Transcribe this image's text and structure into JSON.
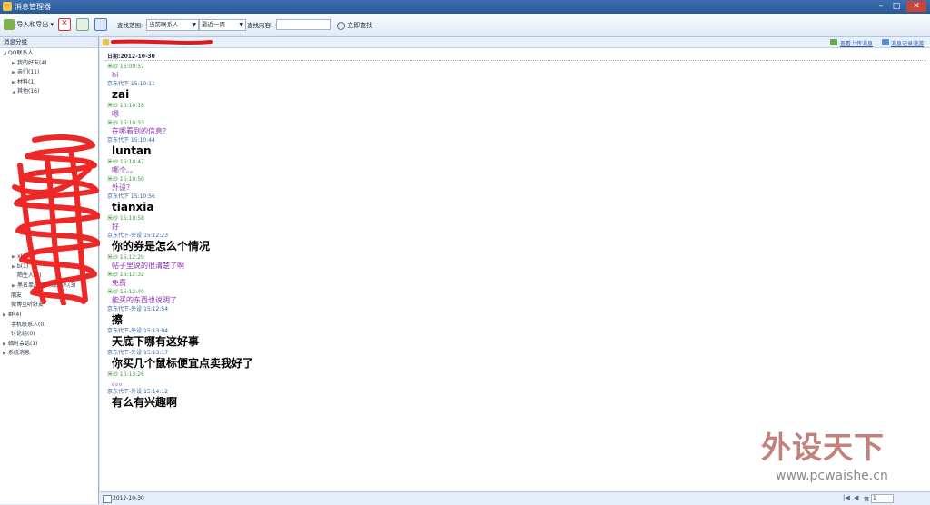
{
  "window": {
    "title": "消息管理器"
  },
  "toolbar": {
    "import_export_label": "导入和导出",
    "scope_label": "查找范围:",
    "scope_value": "当前联系人",
    "range_value": "最近一周",
    "content_label": "查找内容:",
    "search_value": "",
    "search_button_label": "立即查找"
  },
  "sidebar": {
    "header": "消息分组",
    "items": [
      {
        "label": "QQ联系人"
      },
      {
        "label": "我的好友(4)"
      },
      {
        "label": "亲们(11)"
      },
      {
        "label": "材料(1)"
      },
      {
        "label": "其他(16)"
      },
      {
        "label": "x(1)"
      },
      {
        "label": "b(1)"
      },
      {
        "label": "陌生人(0)"
      },
      {
        "label": "黑名单/已删除联系人(3)"
      },
      {
        "label": "朋友"
      },
      {
        "label": "微博互听好友"
      },
      {
        "label": "群(4)"
      },
      {
        "label": "手机联系人(0)"
      },
      {
        "label": "讨论组(0)"
      },
      {
        "label": "临时会话(1)"
      },
      {
        "label": "系统消息"
      }
    ]
  },
  "header": {
    "upload_link": "查看上传消息",
    "cloud_link": "消息记录漫游"
  },
  "conversation": {
    "date": "日期:2012-10-30",
    "messages": [
      {
        "role": "friend",
        "meta": "米纱 15:09:57",
        "text": "hi"
      },
      {
        "role": "me",
        "meta": "京东代下 15:10:11",
        "text": "zai"
      },
      {
        "role": "friend",
        "meta": "米纱 15:10:18",
        "text": "嗯"
      },
      {
        "role": "friend",
        "meta": "米纱 15:10:33",
        "text": "在哪看到的信息？"
      },
      {
        "role": "me",
        "meta": "京东代下 15:10:44",
        "text": "luntan"
      },
      {
        "role": "friend",
        "meta": "米纱 15:10:47",
        "text": "哪个。。"
      },
      {
        "role": "friend",
        "meta": "米纱 15:10:50",
        "text": "外设？"
      },
      {
        "role": "me",
        "meta": "京东代下 15:10:56",
        "text": "tianxia"
      },
      {
        "role": "friend",
        "meta": "米纱 15:10:58",
        "text": "好"
      },
      {
        "role": "me",
        "meta": "京东代下-外设 15:12:23",
        "text": "你的券是怎么个情况"
      },
      {
        "role": "friend",
        "meta": "米纱 15:12:29",
        "text": "帖子里说的很清楚了啊"
      },
      {
        "role": "friend",
        "meta": "米纱 15:12:32",
        "text": "免费"
      },
      {
        "role": "friend",
        "meta": "米纱 15:12:40",
        "text": "能买的东西也说明了"
      },
      {
        "role": "me",
        "meta": "京东代下-外设 15:12:54",
        "text": "擦"
      },
      {
        "role": "me",
        "meta": "京东代下-外设 15:13:04",
        "text": "天底下哪有这好事"
      },
      {
        "role": "me",
        "meta": "京东代下-外设 15:13:17",
        "text": "你买几个鼠标便宜点卖我好了"
      },
      {
        "role": "friend",
        "meta": "米纱 15:13:26",
        "text": "。。。"
      },
      {
        "role": "me",
        "meta": "京东代下-外设 15:14:12",
        "text": "有么有兴趣啊"
      }
    ]
  },
  "statusbar": {
    "date": "2012-10-30",
    "page_label": "第",
    "page_value": "1"
  },
  "watermark": {
    "main": "外设天下",
    "url": "www.pcwaishe.cn"
  },
  "colors": {
    "friend_name": "#3a9a3a",
    "me_name": "#2b65a8",
    "friend_text": "#8c2fb0",
    "me_text": "#000000",
    "title_bar": "#275a96"
  }
}
